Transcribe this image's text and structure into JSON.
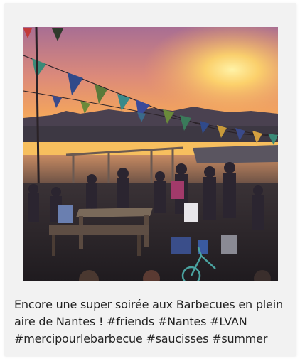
{
  "post": {
    "caption": "Encore une super soirée aux Barbecues en plein aire de Nantes ! #friends #Nantes #LVAN #mercipourlebarbecue #saucisses #summer"
  },
  "colors": {
    "card": "#f2f2f2",
    "caption_text": "#222222",
    "sky_top": "#b06a8a",
    "sun": "#ffd86a"
  }
}
